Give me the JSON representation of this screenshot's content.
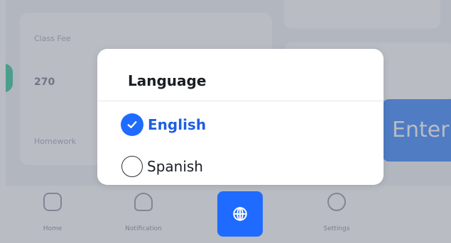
{
  "background": {
    "card": {
      "label": "Class Fee",
      "value": "270",
      "sub_label": "Homework"
    },
    "enter_button_label": "Enter",
    "tabs": [
      {
        "label": "Home",
        "icon": "home-icon"
      },
      {
        "label": "Notification",
        "icon": "bell-icon"
      },
      {
        "label": "Settings",
        "icon": "settings-icon"
      }
    ]
  },
  "language_modal": {
    "title": "Language",
    "options": [
      {
        "label": "English",
        "selected": true
      },
      {
        "label": "Spanish",
        "selected": false
      }
    ]
  },
  "language_button": {
    "icon": "globe-icon"
  },
  "colors": {
    "accent": "#1f6bff",
    "accent_text": "#1f5fe0",
    "overlay": "rgba(115,122,135,0.5)",
    "modal_bg": "#ffffff"
  }
}
